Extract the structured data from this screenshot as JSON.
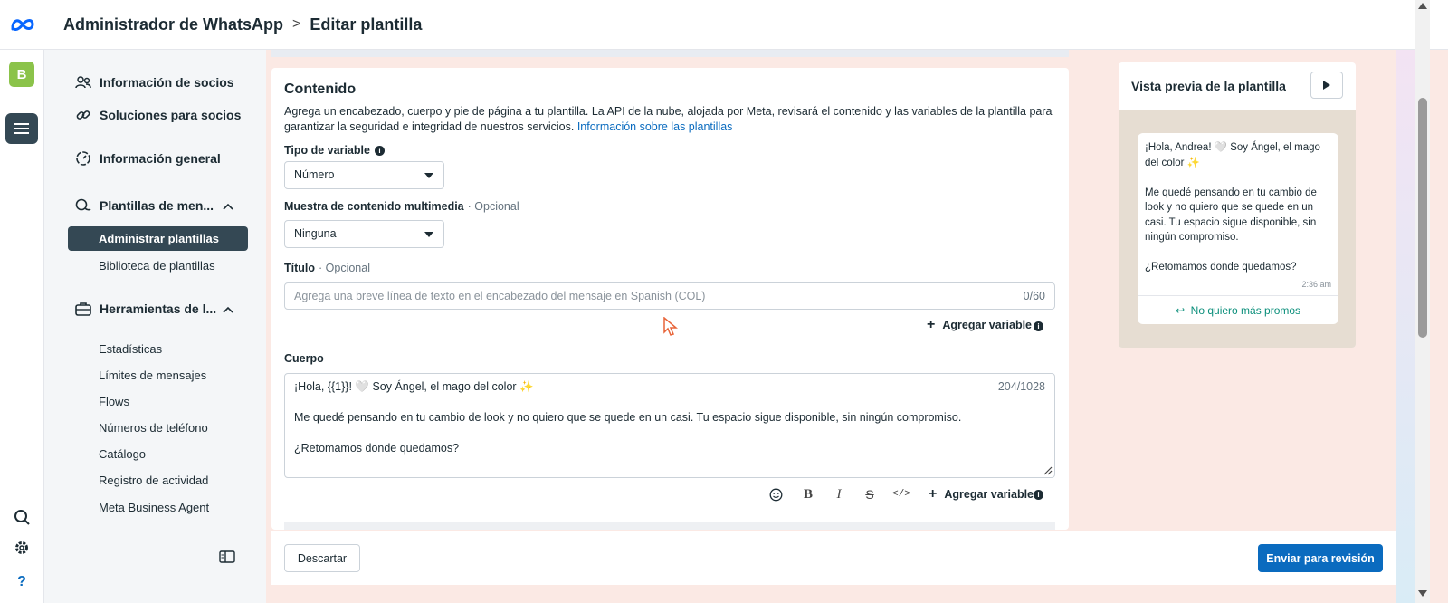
{
  "header": {
    "app_title": "Administrador de WhatsApp",
    "page_title": "Editar plantilla",
    "avatar_letter": "B"
  },
  "sidebar": {
    "items": [
      {
        "label": "Información de socios",
        "icon": "people-icon"
      },
      {
        "label": "Soluciones para socios",
        "icon": "link-icon"
      },
      {
        "label": "Información general",
        "icon": "gauge-icon"
      }
    ],
    "templates_group": {
      "label": "Plantillas de men...",
      "sub": [
        "Administrar plantillas",
        "Biblioteca de plantillas"
      ],
      "active": "Administrar plantillas"
    },
    "tools_group": {
      "label": "Herramientas de l...",
      "sub": [
        "Estadísticas",
        "Límites de mensajes",
        "Flows",
        "Números de teléfono",
        "Catálogo",
        "Registro de actividad",
        "Meta Business Agent"
      ]
    }
  },
  "content": {
    "title": "Contenido",
    "description": "Agrega un encabezado, cuerpo y pie de página a tu plantilla. La API de la nube, alojada por Meta, revisará el contenido y las variables de la plantilla para garantizar la seguridad e integridad de nuestros servicios.",
    "link": "Información sobre las plantillas",
    "variable_type": {
      "label": "Tipo de variable",
      "value": "Número"
    },
    "media_sample": {
      "label": "Muestra de contenido multimedia",
      "optional": "· Opcional",
      "value": "Ninguna"
    },
    "title_field": {
      "label": "Título",
      "optional": "· Opcional",
      "placeholder": "Agrega una breve línea de texto en el encabezado del mensaje en Spanish (COL)",
      "counter": "0/60"
    },
    "add_variable": "Agregar variable",
    "body": {
      "label": "Cuerpo",
      "counter": "204/1028",
      "line1": "¡Hola, {{1}}! 🤍 Soy Ángel, el mago del color ✨",
      "line2": "Me quedé pensando en tu cambio de look y no quiero que se quede en un casi. Tu espacio sigue disponible, sin ningún compromiso.",
      "line3": "¿Retomamos donde quedamos?"
    }
  },
  "footer": {
    "discard": "Descartar",
    "submit": "Enviar para revisión"
  },
  "preview": {
    "title": "Vista previa de la plantilla",
    "p1": "¡Hola, Andrea! 🤍 Soy Ángel, el mago del color ✨",
    "p2": "Me quedé pensando en tu cambio de look y no quiero que se quede en un casi. Tu espacio sigue disponible, sin ningún compromiso.",
    "p3": "¿Retomamos donde quedamos?",
    "time": "2:36 am",
    "quick_reply": "No quiero más promos"
  },
  "colors": {
    "accent": "#0a6bbf",
    "sidebar_active": "#344854",
    "reply": "#0b8f7b"
  }
}
